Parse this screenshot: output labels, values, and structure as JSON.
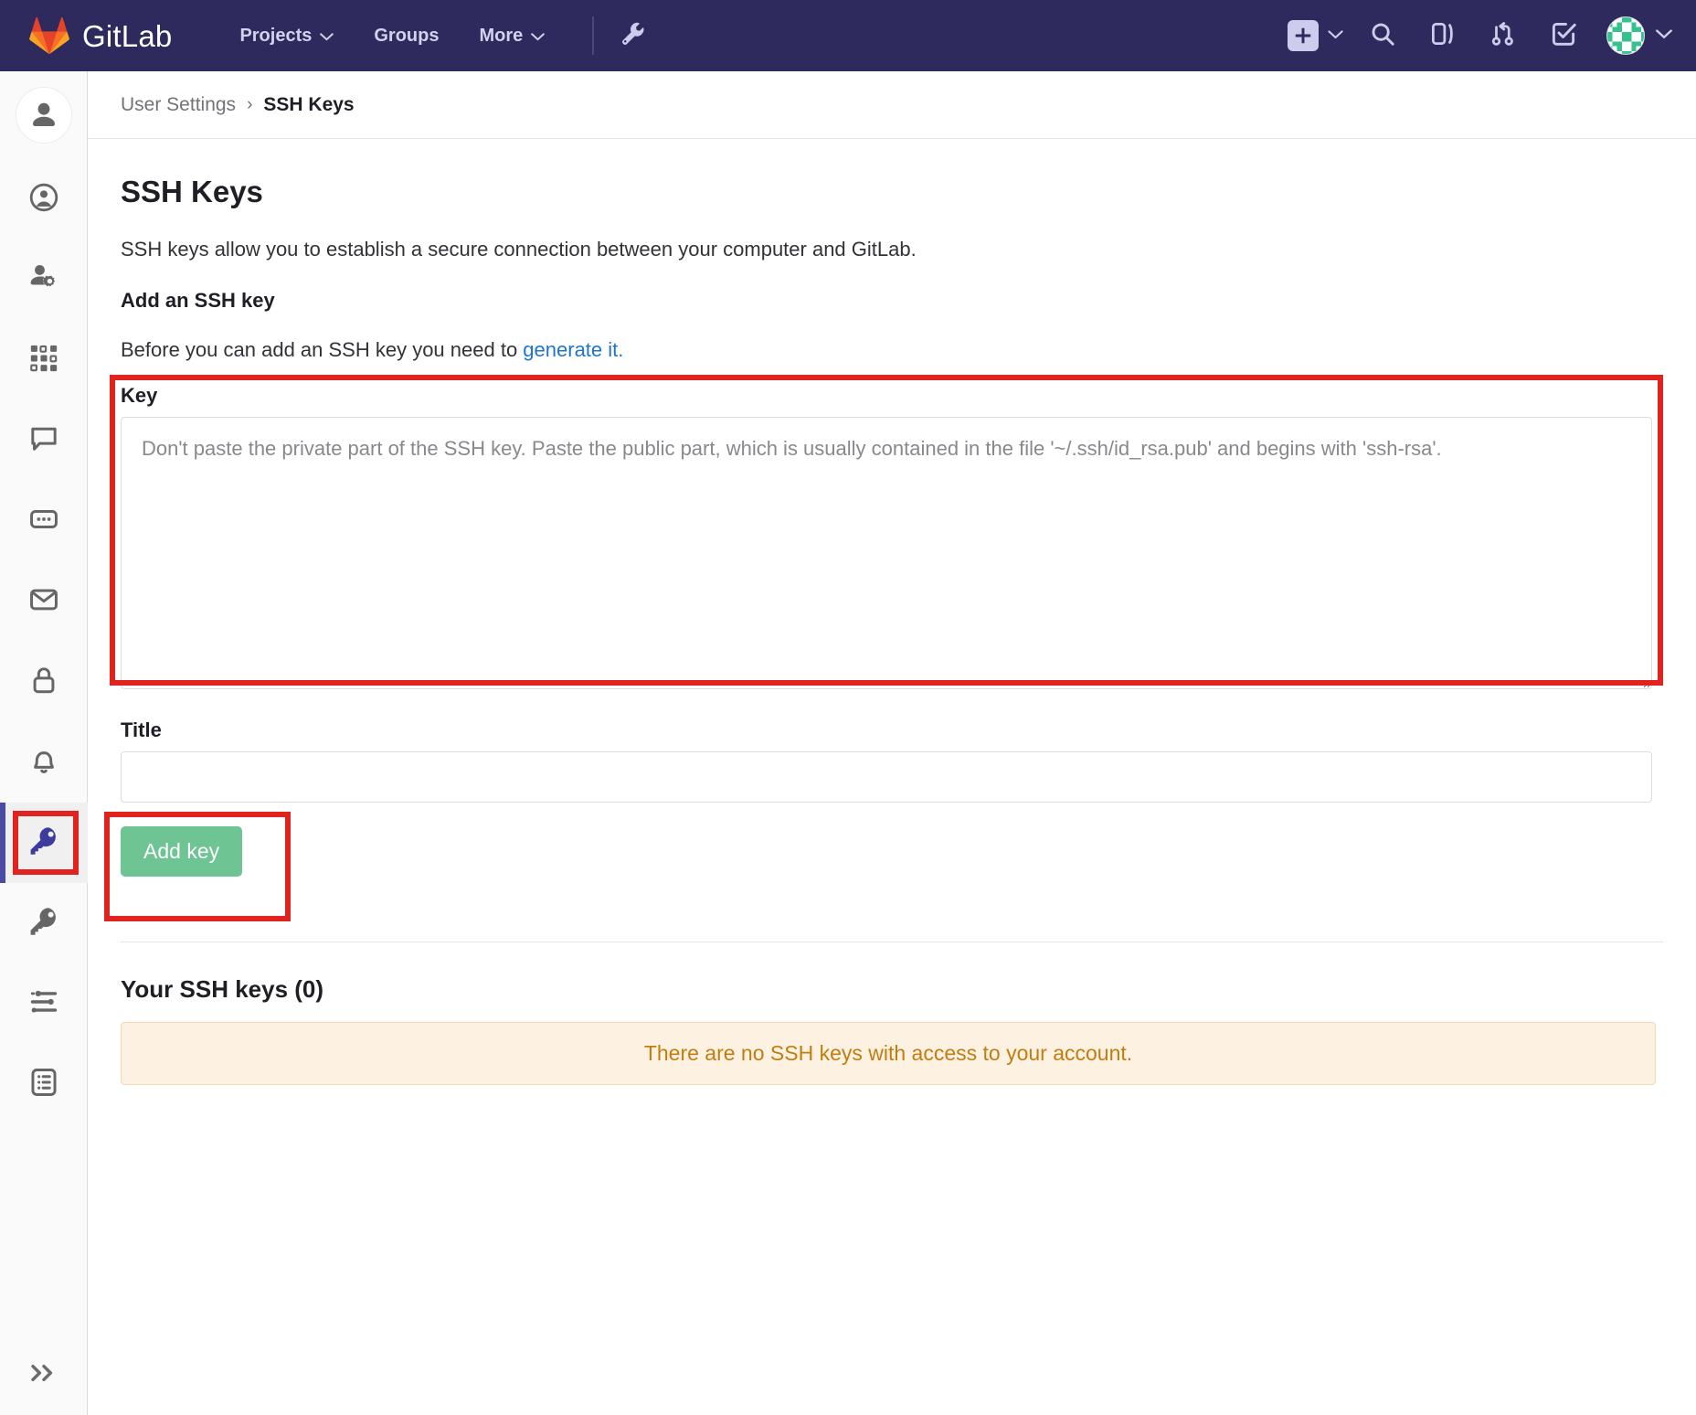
{
  "navbar": {
    "brand": "GitLab",
    "brand_logo_icon": "gitlab-logo-icon",
    "links": [
      {
        "label": "Projects",
        "icon": "chevron-down-icon",
        "has_caret": true
      },
      {
        "label": "Groups",
        "icon": "",
        "has_caret": false
      },
      {
        "label": "More",
        "icon": "chevron-down-icon",
        "has_caret": true
      }
    ],
    "tool_icon": "wrench-icon",
    "right_icons": [
      {
        "name": "plus-square-icon",
        "label": "New"
      },
      {
        "name": "chevron-down-icon",
        "label": ""
      },
      {
        "name": "search-icon",
        "label": "Search"
      },
      {
        "name": "issues-icon",
        "label": "Issues"
      },
      {
        "name": "merge-request-icon",
        "label": "Merge requests"
      },
      {
        "name": "todo-check-icon",
        "label": "To-Do list"
      },
      {
        "name": "avatar",
        "label": "User menu"
      },
      {
        "name": "chevron-down-icon",
        "label": ""
      }
    ],
    "bg_color": "#2e2a5d"
  },
  "sidebar": {
    "items": [
      {
        "icon": "user-avatar-icon",
        "label": "Profile avatar",
        "active": false
      },
      {
        "icon": "account-circle-icon",
        "label": "Profile",
        "active": false
      },
      {
        "icon": "user-settings-icon",
        "label": "Account",
        "active": false
      },
      {
        "icon": "applications-grid-icon",
        "label": "Applications",
        "active": false
      },
      {
        "icon": "chat-icon",
        "label": "Chat",
        "active": false
      },
      {
        "icon": "access-tokens-icon",
        "label": "Access Tokens",
        "active": false
      },
      {
        "icon": "email-icon",
        "label": "Emails",
        "active": false
      },
      {
        "icon": "lock-icon",
        "label": "Password",
        "active": false
      },
      {
        "icon": "bell-icon",
        "label": "Notifications",
        "active": false
      },
      {
        "icon": "key-icon",
        "label": "SSH Keys",
        "active": true
      },
      {
        "icon": "key-outline-icon",
        "label": "GPG Keys",
        "active": false
      },
      {
        "icon": "preferences-sliders-icon",
        "label": "Preferences",
        "active": false
      },
      {
        "icon": "list-document-icon",
        "label": "Active Sessions",
        "active": false
      }
    ],
    "toggle_icon": "chevron-double-right-icon",
    "active_indicator_color": "#4c4ba3"
  },
  "breadcrumb": {
    "parent": "User Settings",
    "separator": "›",
    "current": "SSH Keys"
  },
  "main": {
    "title": "SSH Keys",
    "description": "SSH keys allow you to establish a secure connection between your computer and GitLab.",
    "subheading": "Add an SSH key",
    "generate_prefix": "Before you can add an SSH key you need to ",
    "generate_link": "generate it.",
    "key_label": "Key",
    "key_value": "",
    "key_placeholder": "Don't paste the private part of the SSH key. Paste the public part, which is usually contained in the file '~/.ssh/id_rsa.pub' and begins with 'ssh-rsa'.",
    "title_label": "Title",
    "title_value": "",
    "title_placeholder": "",
    "add_key_button": "Add key",
    "keys_section_heading": "Your SSH keys (0)",
    "empty_alert": "There are no SSH keys with access to your account."
  },
  "annotations": {
    "color": "#e0231e",
    "boxes": [
      {
        "name": "key-field-highlight",
        "target": "key-group"
      },
      {
        "name": "add-key-button-highlight",
        "target": "add-key-button"
      },
      {
        "name": "ssh-keys-sidebar-highlight",
        "target": "sidebar-item-ssh-keys"
      }
    ]
  },
  "colors": {
    "navbar": "#2e2a5d",
    "link": "#1f75cb",
    "button_green": "#6ec493",
    "alert_bg": "#fdf1e1",
    "alert_text": "#c17d10",
    "annotation_red": "#e0231e",
    "active_sidebar": "#4c4ba3"
  }
}
